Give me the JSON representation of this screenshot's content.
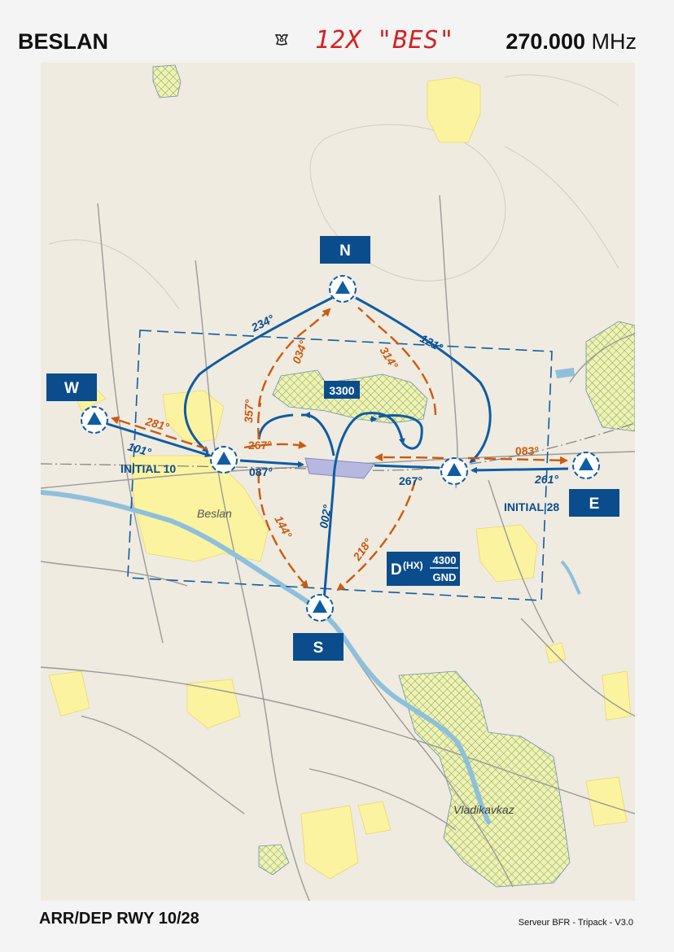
{
  "header": {
    "title": "BESLAN",
    "channel": "12X \"BES\"",
    "frequency_value": "270.000",
    "frequency_unit": "MHz"
  },
  "map": {
    "waypoints": {
      "north": "N",
      "south": "S",
      "east": "E",
      "west": "W"
    },
    "cities": {
      "beslan": "Beslan",
      "vladikavkaz": "Vladikavkaz"
    },
    "initials": {
      "initial_10": "INITIAL 10",
      "initial_28": "INITIAL 28"
    },
    "headings": {
      "w_to_i10": "101°",
      "i10_to_w": "281°",
      "n_to_i10": "234°",
      "i10_to_n": "034°",
      "n_to_i28": "121°",
      "i28_to_n": "314°",
      "i10_357": "357°",
      "i10_267": "267°",
      "i10_087": "087°",
      "i28_267": "267°",
      "i28_083": "083°",
      "e_261": "261°",
      "s_002": "002°",
      "i10_144": "144°",
      "i28_218": "218°"
    },
    "altitude_box": "3300",
    "danger_area": {
      "designator": "D",
      "id": "(HX)",
      "upper": "4300",
      "lower": "GND"
    },
    "colors": {
      "blue": "#0f5ca3",
      "orange": "#cc5a10",
      "label_blue": "#0b4d8c"
    }
  },
  "footer": {
    "left": "ARR/DEP RWY 10/28",
    "right": "Serveur BFR - Tripack - V3.0"
  }
}
